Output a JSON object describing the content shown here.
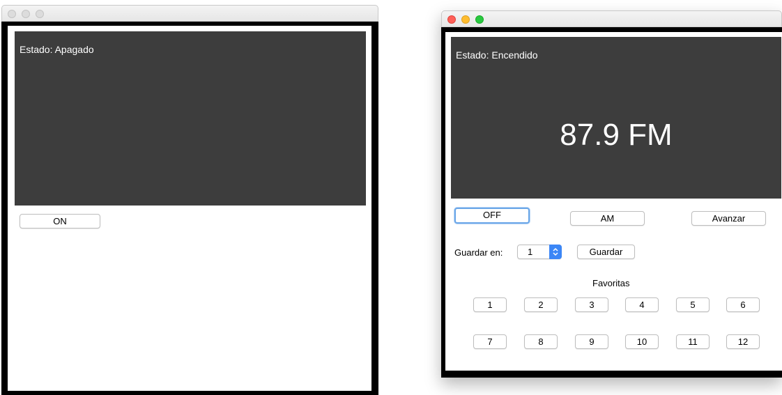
{
  "left_window": {
    "status": "Estado: Apagado",
    "power_button": "ON"
  },
  "right_window": {
    "status": "Estado: Encendido",
    "frequency": "87.9 FM",
    "power_button": "OFF",
    "band_button": "AM",
    "next_button": "Avanzar",
    "save_label": "Guardar en:",
    "save_slot": "1",
    "save_button": "Guardar",
    "favorites_label": "Favoritas",
    "favorites": [
      "1",
      "2",
      "3",
      "4",
      "5",
      "6",
      "7",
      "8",
      "9",
      "10",
      "11",
      "12"
    ]
  },
  "colors": {
    "screen": "#3d3d3d",
    "frame": "#000000",
    "accent": "#3b86f6"
  }
}
